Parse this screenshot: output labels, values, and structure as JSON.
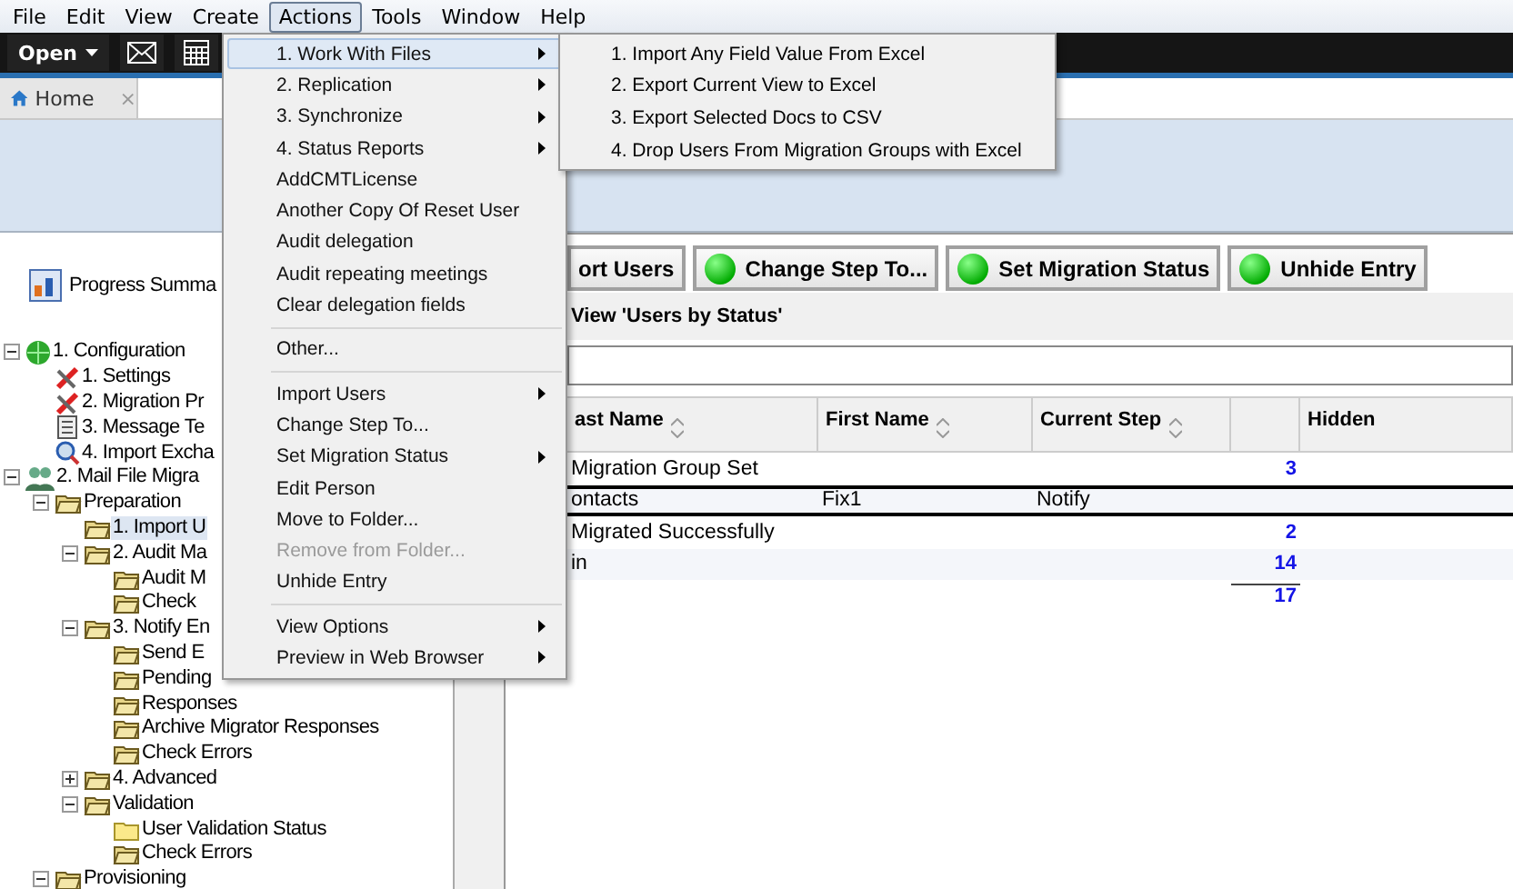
{
  "menubar": [
    {
      "label": "File",
      "selected": false
    },
    {
      "label": "Edit",
      "selected": false
    },
    {
      "label": "View",
      "selected": false
    },
    {
      "label": "Create",
      "selected": false
    },
    {
      "label": "Actions",
      "selected": true
    },
    {
      "label": "Tools",
      "selected": false
    },
    {
      "label": "Window",
      "selected": false
    },
    {
      "label": "Help",
      "selected": false
    }
  ],
  "toolbar": {
    "open_label": "Open"
  },
  "tabs": [
    {
      "label": "Home",
      "close": "×",
      "selected": true
    }
  ],
  "sidebar": {
    "summary": "Progress Summa",
    "tree": [
      {
        "label": "1. Configuration",
        "kind": "globe",
        "expanded": true,
        "selected": false,
        "children": [
          {
            "label": "1. Settings",
            "kind": "tools",
            "selected": false
          },
          {
            "label": "2. Migration Pr",
            "kind": "tools",
            "selected": false
          },
          {
            "label": "3. Message Te",
            "kind": "document",
            "selected": false
          },
          {
            "label": "4. Import Excha",
            "kind": "search",
            "selected": false
          }
        ]
      },
      {
        "label": "2. Mail File Migra",
        "kind": "people",
        "expanded": true,
        "selected": false,
        "children": [
          {
            "label": "Preparation",
            "kind": "folder",
            "expanded": true,
            "selected": false,
            "children": [
              {
                "label": "1. Import U",
                "kind": "folder",
                "selected": true
              },
              {
                "label": "2. Audit Ma",
                "kind": "folder",
                "expanded": true,
                "selected": false,
                "children": [
                  {
                    "label": "Audit M",
                    "kind": "folder",
                    "selected": false
                  },
                  {
                    "label": "Check",
                    "kind": "folder",
                    "selected": false
                  }
                ]
              },
              {
                "label": "3. Notify En",
                "kind": "folder",
                "expanded": true,
                "selected": false,
                "children": [
                  {
                    "label": "Send E",
                    "kind": "folder",
                    "selected": false
                  },
                  {
                    "label": "Pending",
                    "kind": "folder",
                    "selected": false
                  },
                  {
                    "label": "Responses",
                    "kind": "folder",
                    "selected": false
                  },
                  {
                    "label": "Archive Migrator Responses",
                    "kind": "folder",
                    "selected": false
                  },
                  {
                    "label": "Check Errors",
                    "kind": "folder",
                    "selected": false
                  }
                ]
              },
              {
                "label": "4. Advanced",
                "kind": "folder",
                "expanded": false,
                "selected": false
              },
              {
                "label": "Validation",
                "kind": "folder",
                "expanded": true,
                "selected": false,
                "children": [
                  {
                    "label": "User Validation Status",
                    "kind": "plain-folder",
                    "selected": false
                  },
                  {
                    "label": "Check Errors",
                    "kind": "folder",
                    "selected": false
                  }
                ]
              }
            ]
          },
          {
            "label": "Provisioning",
            "kind": "folder",
            "expanded": true,
            "selected": false
          }
        ]
      }
    ]
  },
  "actions": [
    {
      "label": "ort Users",
      "has_icon": false
    },
    {
      "label": "Change Step To...",
      "has_icon": true
    },
    {
      "label": "Set Migration Status",
      "has_icon": true
    },
    {
      "label": "Unhide Entry",
      "has_icon": true
    }
  ],
  "view_title": "View 'Users by Status'",
  "table": {
    "columns": [
      {
        "label": "ast Name",
        "sortable": true
      },
      {
        "label": "First Name",
        "sortable": true
      },
      {
        "label": "Current Step",
        "sortable": true
      },
      {
        "sortable": false
      },
      {
        "label": "Hidden",
        "sortable": false
      }
    ],
    "rows": [
      {
        "kind": "category",
        "selected": false,
        "cells": [
          "Migration Group Set",
          "",
          "",
          "3",
          ""
        ]
      },
      {
        "kind": "document",
        "selected": true,
        "cells": [
          "ontacts",
          "Fix1",
          "Notify",
          "",
          ""
        ]
      },
      {
        "kind": "category",
        "selected": false,
        "cells": [
          "Migrated Successfully",
          "",
          "",
          "2",
          ""
        ]
      },
      {
        "kind": "category",
        "selected": false,
        "cells": [
          "in",
          "",
          "",
          "14",
          ""
        ]
      },
      {
        "kind": "total",
        "selected": false,
        "cells": [
          "",
          "",
          "",
          "17",
          ""
        ]
      }
    ]
  },
  "actions_menu": [
    {
      "kind": "item",
      "label": "1. Work With Files",
      "submenu": true,
      "selected": true,
      "disabled": false
    },
    {
      "kind": "item",
      "label": "2. Replication",
      "submenu": true,
      "selected": false,
      "disabled": false
    },
    {
      "kind": "item",
      "label": "3. Synchronize",
      "submenu": true,
      "selected": false,
      "disabled": false
    },
    {
      "kind": "item",
      "label": "4. Status Reports",
      "submenu": true,
      "selected": false,
      "disabled": false
    },
    {
      "kind": "item",
      "label": "AddCMTLicense",
      "submenu": false,
      "selected": false,
      "disabled": false
    },
    {
      "kind": "item",
      "label": "Another Copy Of Reset User",
      "submenu": false,
      "selected": false,
      "disabled": false
    },
    {
      "kind": "item",
      "label": "Audit delegation",
      "submenu": false,
      "selected": false,
      "disabled": false
    },
    {
      "kind": "item",
      "label": "Audit repeating meetings",
      "submenu": false,
      "selected": false,
      "disabled": false
    },
    {
      "kind": "item",
      "label": "Clear delegation fields",
      "submenu": false,
      "selected": false,
      "disabled": false
    },
    {
      "kind": "separator"
    },
    {
      "kind": "item",
      "label": "Other...",
      "submenu": false,
      "selected": false,
      "disabled": false
    },
    {
      "kind": "separator"
    },
    {
      "kind": "item",
      "label": "Import Users",
      "submenu": true,
      "selected": false,
      "disabled": false
    },
    {
      "kind": "item",
      "label": "Change Step To...",
      "submenu": false,
      "selected": false,
      "disabled": false
    },
    {
      "kind": "item",
      "label": "Set Migration Status",
      "submenu": true,
      "selected": false,
      "disabled": false
    },
    {
      "kind": "item",
      "label": "Edit Person",
      "submenu": false,
      "selected": false,
      "disabled": false
    },
    {
      "kind": "item",
      "label": "Move to Folder...",
      "submenu": false,
      "selected": false,
      "disabled": false
    },
    {
      "kind": "item",
      "label": "Remove from Folder...",
      "submenu": false,
      "selected": false,
      "disabled": true
    },
    {
      "kind": "item",
      "label": "Unhide Entry",
      "submenu": false,
      "selected": false,
      "disabled": false
    },
    {
      "kind": "separator"
    },
    {
      "kind": "item",
      "label": "View Options",
      "submenu": true,
      "selected": false,
      "disabled": false
    },
    {
      "kind": "item",
      "label": "Preview in Web Browser",
      "submenu": true,
      "selected": false,
      "disabled": false
    }
  ],
  "files_submenu": [
    "1. Import Any Field Value From Excel",
    "2. Export Current View to Excel",
    "3. Export Selected Docs to CSV",
    "4. Drop Users From Migration Groups with Excel"
  ]
}
